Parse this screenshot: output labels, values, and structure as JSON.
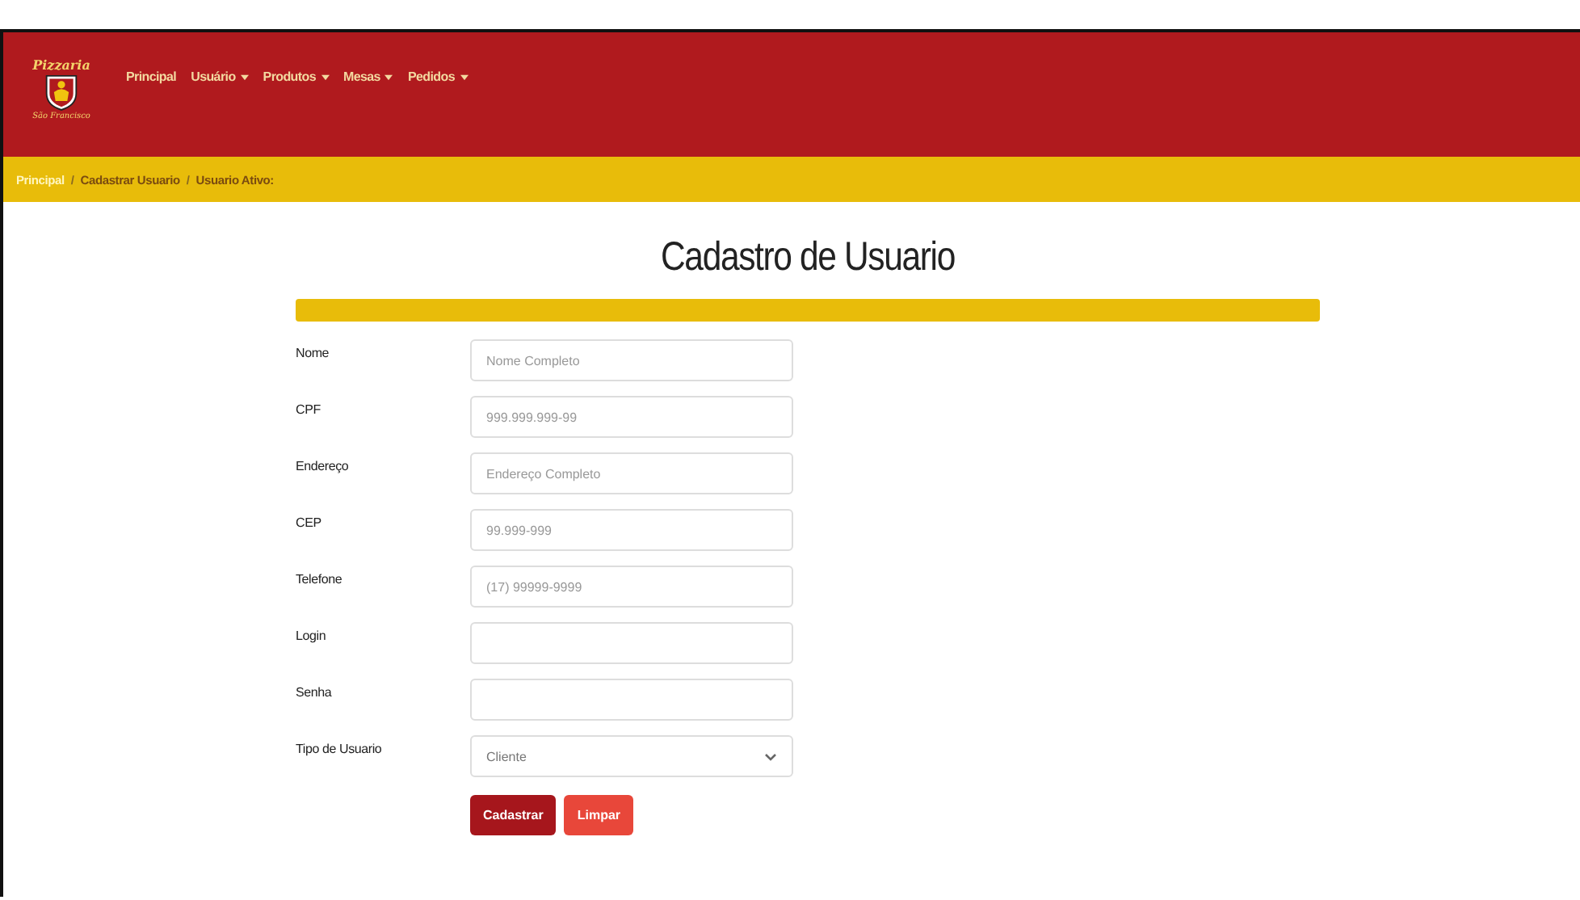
{
  "logo": {
    "title": "Pizzaria",
    "subtitle": "São Francisco"
  },
  "nav": [
    {
      "label": "Principal",
      "dropdown": false
    },
    {
      "label": "Usuário",
      "dropdown": true
    },
    {
      "label": "Produtos",
      "dropdown": true
    },
    {
      "label": "Mesas",
      "dropdown": true
    },
    {
      "label": "Pedidos",
      "dropdown": true
    }
  ],
  "breadcrumb": [
    {
      "label": "Principal",
      "selected": true
    },
    {
      "separator": "/",
      "label": "Cadastrar Usuario",
      "selected": false
    },
    {
      "separator": "/",
      "label": "Usuario Ativo:",
      "selected": false
    }
  ],
  "form": {
    "title": "Cadastro de Usuario",
    "fields": [
      {
        "kind": "text",
        "label": "Nome",
        "placeholder": "Nome Completo"
      },
      {
        "kind": "text",
        "label": "CPF",
        "placeholder": "999.999.999-99"
      },
      {
        "kind": "text",
        "label": "Endereço",
        "placeholder": "Endereço Completo"
      },
      {
        "kind": "text",
        "label": "CEP",
        "placeholder": "99.999-999"
      },
      {
        "kind": "text",
        "label": "Telefone",
        "placeholder": "(17) 99999-9999"
      },
      {
        "kind": "text",
        "label": "Login"
      },
      {
        "kind": "password",
        "label": "Senha"
      },
      {
        "kind": "select",
        "label": "Tipo de Usuario",
        "value": "Cliente"
      }
    ],
    "buttons": [
      {
        "label": "Cadastrar",
        "kind": "primary"
      },
      {
        "label": "Limpar",
        "kind": "secondary"
      }
    ]
  }
}
